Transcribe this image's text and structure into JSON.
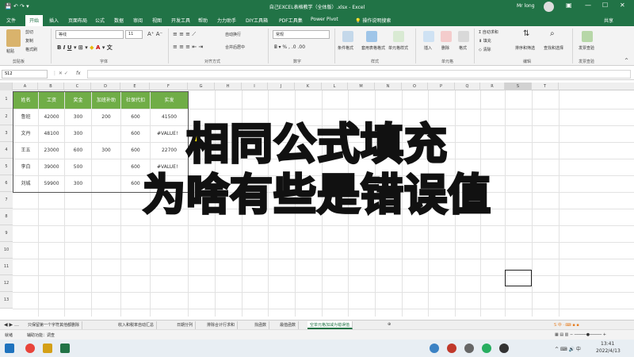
{
  "window": {
    "title": "自己EXCEL表格教学（全体版）.xlsx - Excel",
    "user": "Mr long"
  },
  "menu": {
    "items": [
      "文件",
      "开始",
      "插入",
      "页面布局",
      "公式",
      "数据",
      "审阅",
      "视图",
      "开发工具",
      "帮助",
      "力力助手",
      "DIY工具箱",
      "PDF工具集",
      "Power Pivot"
    ],
    "active_index": 1,
    "tell_me": "操作说明搜索",
    "share": "共享"
  },
  "ribbon": {
    "clipboard": {
      "cut": "剪切",
      "copy": "复制",
      "format_painter": "格式刷",
      "paste": "粘贴",
      "group": "剪贴板"
    },
    "font": {
      "name": "等线",
      "size": "11",
      "group": "字体"
    },
    "alignment": {
      "wrap": "自动换行",
      "merge": "合并后居中",
      "group": "对齐方式"
    },
    "number": {
      "format": "常规",
      "group": "数字"
    },
    "styles": {
      "conditional": "条件格式",
      "table": "套用表格格式",
      "cell": "单元格样式",
      "group": "样式"
    },
    "cells": {
      "insert": "插入",
      "delete": "删除",
      "format": "格式",
      "group": "单元格"
    },
    "editing": {
      "autosum": "自动求和",
      "fill": "填充",
      "clear": "清除",
      "sort": "排序和筛选",
      "find": "查找和选择",
      "group": "编辑"
    },
    "invoice": {
      "label": "发票查验",
      "group": "发票查验"
    }
  },
  "formula_bar": {
    "name_box": "S12",
    "fx": "fx",
    "value": ""
  },
  "columns": [
    "A",
    "B",
    "C",
    "D",
    "E",
    "F",
    "G",
    "H",
    "I",
    "J",
    "K",
    "L",
    "M",
    "N",
    "O",
    "P",
    "Q",
    "R",
    "S",
    "T"
  ],
  "rows": [
    "1",
    "2",
    "3",
    "4",
    "5",
    "6",
    "7",
    "8",
    "9",
    "10",
    "11",
    "12",
    "13"
  ],
  "table": {
    "headers": [
      "姓名",
      "工资",
      "奖金",
      "加班补助",
      "社保代扣",
      "实发"
    ],
    "rows": [
      [
        "鲁班",
        "42000",
        "300",
        "200",
        "600",
        "41500"
      ],
      [
        "文丹",
        "48100",
        "300",
        "",
        "600",
        "#VALUE!"
      ],
      [
        "王五",
        "23000",
        "600",
        "300",
        "600",
        "22700"
      ],
      [
        "李白",
        "39000",
        "500",
        "",
        "600",
        "#VALUE!"
      ],
      [
        "刘城",
        "59900",
        "300",
        "",
        "600",
        ""
      ]
    ]
  },
  "sheets": {
    "tabs": [
      "只保留第一个字符其他都删除",
      "收入和税率自动汇总",
      "日期分列",
      "排除合计行求和",
      "找函数",
      "最值函数",
      "空单元格加减为错误值"
    ],
    "active_index": 6
  },
  "status": {
    "text": "就绪",
    "accessibility": "辅助功能：调查"
  },
  "taskbar": {
    "time": "13:41",
    "date": "2022/4/13"
  },
  "overlay": {
    "line1": "相同公式填充",
    "line2": "为啥有些是错误值"
  }
}
